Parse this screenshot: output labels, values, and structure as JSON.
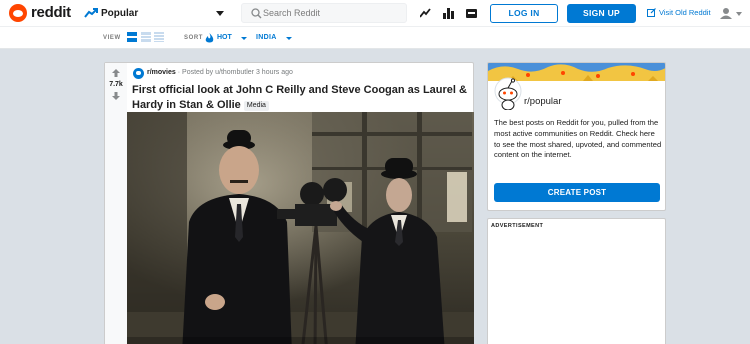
{
  "header": {
    "logo_text": "reddit",
    "feed_label": "Popular",
    "search_placeholder": "Search Reddit",
    "login_label": "LOG IN",
    "signup_label": "SIGN UP",
    "old_reddit_label": "Visit Old Reddit"
  },
  "subheader": {
    "view_label": "VIEW",
    "sort_label": "SORT",
    "sort_value": "HOT",
    "region_value": "INDIA"
  },
  "post": {
    "score": "7.7k",
    "subreddit": "r/movies",
    "posted_by": "· Posted by u/thombutler 3 hours ago",
    "title": "First official look at John C Reilly and Steve Coogan as Laurel & Hardy in Stan & Ollie",
    "flair": "Media"
  },
  "sidebar": {
    "title": "r/popular",
    "description": "The best posts on Reddit for you, pulled from the most active communities on Reddit. Check here to see the most shared, upvoted, and commented content on the internet.",
    "create_post_label": "CREATE POST",
    "ad_label": "ADVERTISEMENT"
  },
  "colors": {
    "accent": "#0079d3",
    "brand": "#ff4500",
    "background": "#dae0e6"
  },
  "icons": [
    "popular-icon",
    "search-icon",
    "trending-icon",
    "stats-icon",
    "chat-icon",
    "external-link-icon",
    "user-icon",
    "upvote-icon",
    "downvote-icon",
    "hot-icon"
  ]
}
